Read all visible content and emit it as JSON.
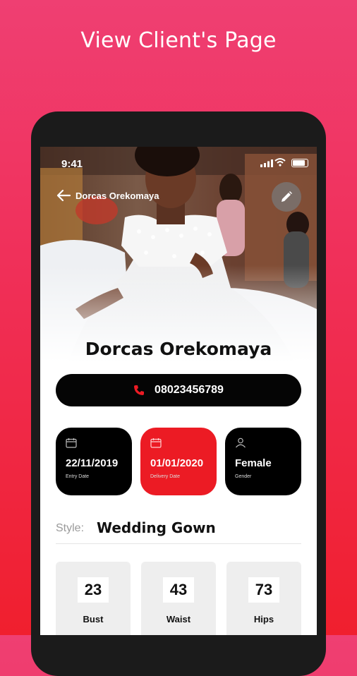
{
  "promo": {
    "title": "View Client's Page"
  },
  "status_bar": {
    "time": "9:41"
  },
  "header": {
    "back_label": "Dorcas Orekomaya"
  },
  "client": {
    "name": "Dorcas Orekomaya",
    "phone": "08023456789"
  },
  "dates": {
    "entry": {
      "value": "22/11/2019",
      "label": "Entry Date"
    },
    "delivery": {
      "value": "01/01/2020",
      "label": "Delivery Date"
    },
    "gender": {
      "value": "Female",
      "label": "Gender"
    }
  },
  "style": {
    "label": "Style:",
    "value": "Wedding Gown"
  },
  "measurements": [
    {
      "value": "23",
      "label": "Bust"
    },
    {
      "value": "43",
      "label": "Waist"
    },
    {
      "value": "73",
      "label": "Hips"
    }
  ],
  "colors": {
    "accent": "#ec1b24",
    "card_dark": "#000000",
    "background_top": "#ef3f72",
    "background_bottom": "#f01f2e"
  },
  "icons": [
    "back-arrow-icon",
    "edit-pencil-icon",
    "phone-icon",
    "calendar-icon",
    "user-icon",
    "signal-icon",
    "wifi-icon",
    "battery-icon"
  ]
}
